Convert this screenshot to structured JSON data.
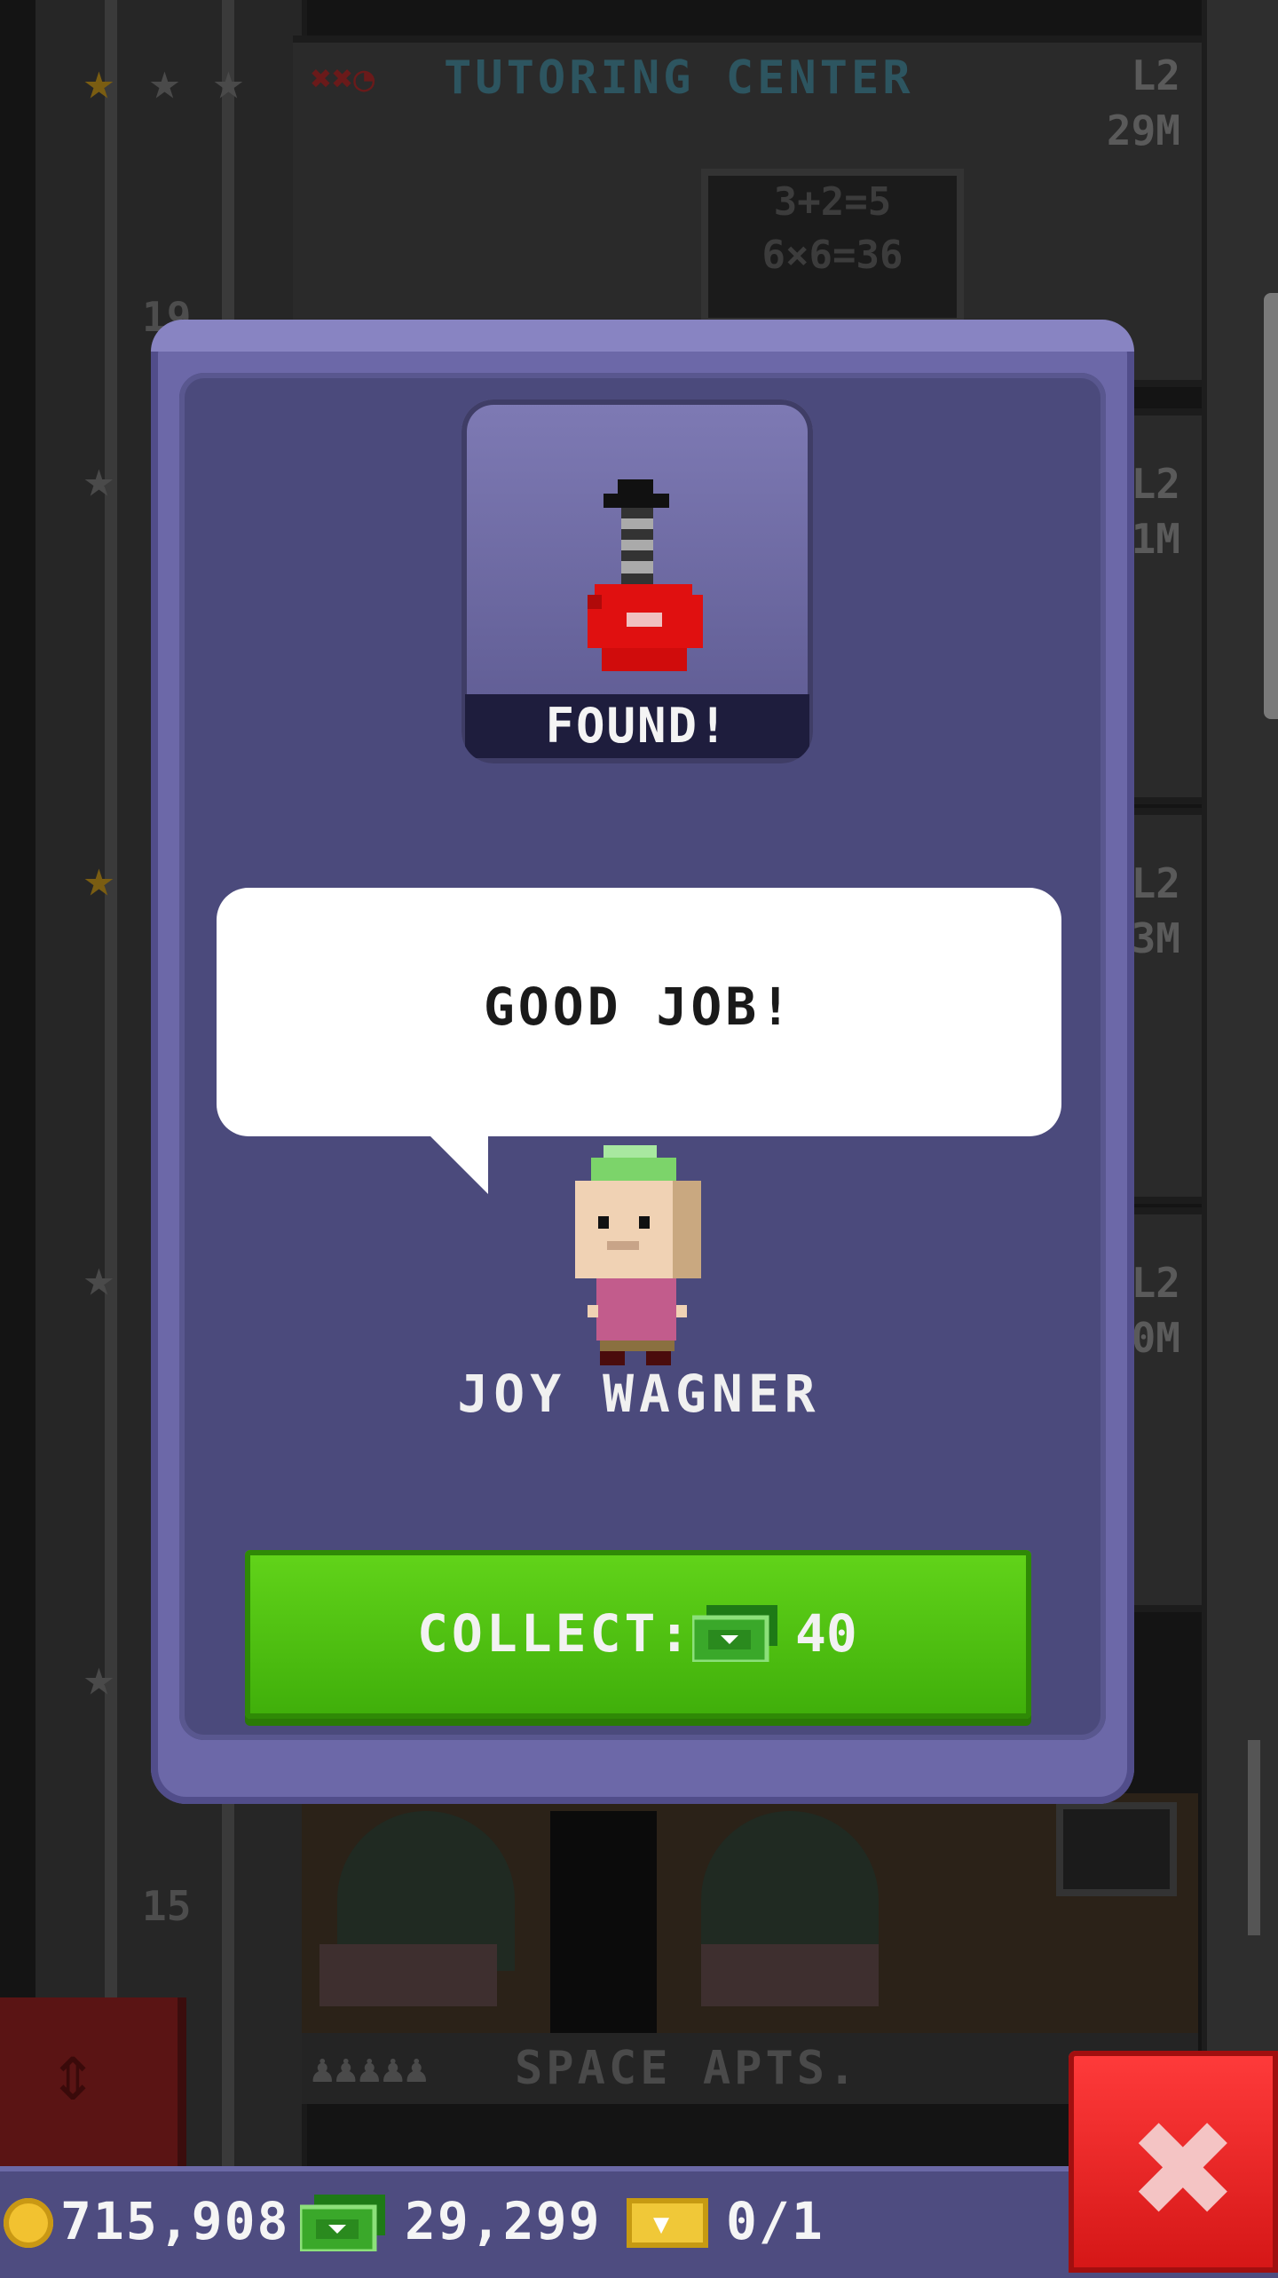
{
  "background": {
    "floors": [
      {
        "title": "TUTORING CENTER",
        "level": "L2",
        "value": "29M",
        "marks": "✖✖◔"
      },
      {
        "level": "L2",
        "value": "1M"
      },
      {
        "level": "L2",
        "value": "3M"
      },
      {
        "level": "L2",
        "value": "0M"
      }
    ],
    "floor_numbers": [
      "19",
      "15"
    ],
    "chalkboard_text": "3+2=5\n6×6=36",
    "bottom_floor_label": "SPACE APTS."
  },
  "modal": {
    "status_label": "FOUND!",
    "speech_text": "GOOD JOB!",
    "character_name": "JOY WAGNER",
    "collect_label": "COLLECT:",
    "collect_amount": "40",
    "item_icon": "red-guitar-icon",
    "currency_icon": "tower-bux-icon"
  },
  "status_bar": {
    "coins": "715,908",
    "bux": "29,299",
    "tickets": "0/1"
  },
  "colors": {
    "modal_bg": "#6c68a8",
    "modal_inner": "#4b4a7c",
    "collect_green": "#4fc012",
    "close_red": "#e52424",
    "coin_gold": "#f2c230"
  }
}
